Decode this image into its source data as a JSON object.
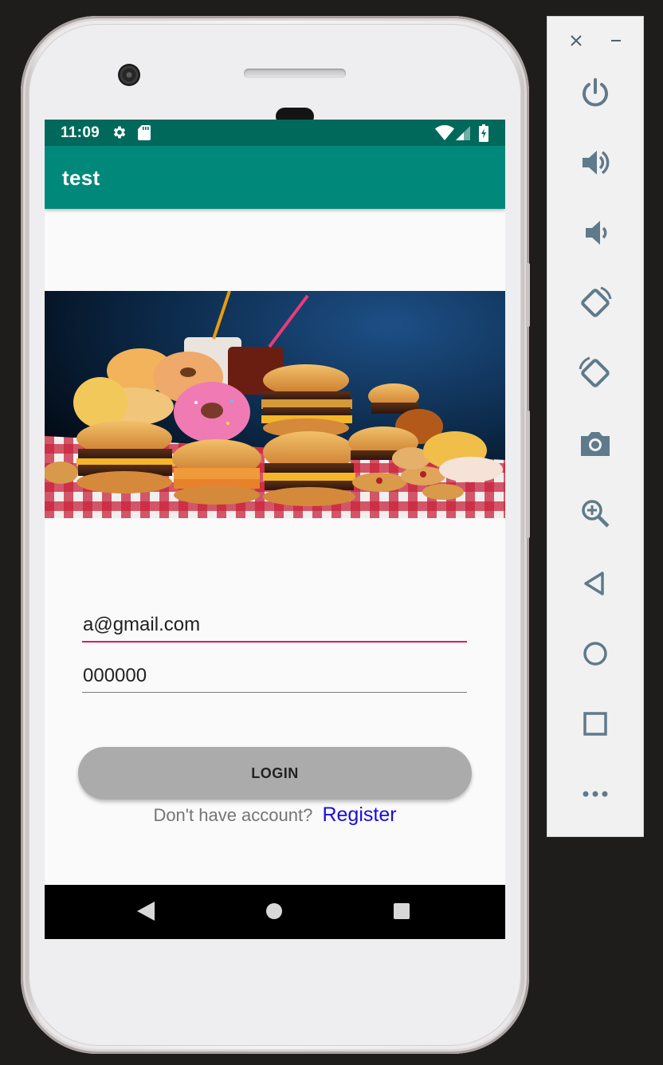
{
  "status_bar": {
    "time": "11:09",
    "icons": [
      "gear-icon",
      "sd-card-icon",
      "wifi-icon",
      "signal-icon",
      "battery-charging-icon"
    ],
    "color": "#00695c"
  },
  "app_bar": {
    "title": "test",
    "color": "#00897b"
  },
  "hero_image": {
    "description_icon": "fast-food-image"
  },
  "form": {
    "email": {
      "value": "a@gmail.com",
      "underline_color": "#d81b60"
    },
    "password": {
      "value": "000000"
    },
    "login_button": {
      "label": "LOGIN",
      "color": "#ababab"
    },
    "register_prompt": "Don't have account?",
    "register_link": "Register",
    "link_color": "#1a0ddb"
  },
  "nav_bar": {
    "icons": [
      "back-icon",
      "home-icon",
      "recents-icon"
    ]
  },
  "emulator_panel": {
    "window_controls": [
      "close-icon",
      "minimize-icon"
    ],
    "buttons": [
      "power-icon",
      "volume-up-icon",
      "volume-down-icon",
      "rotate-left-icon",
      "rotate-right-icon",
      "screenshot-icon",
      "zoom-icon",
      "back-icon",
      "home-icon",
      "overview-icon",
      "more-icon"
    ],
    "icon_color": "#5f7a8a"
  }
}
